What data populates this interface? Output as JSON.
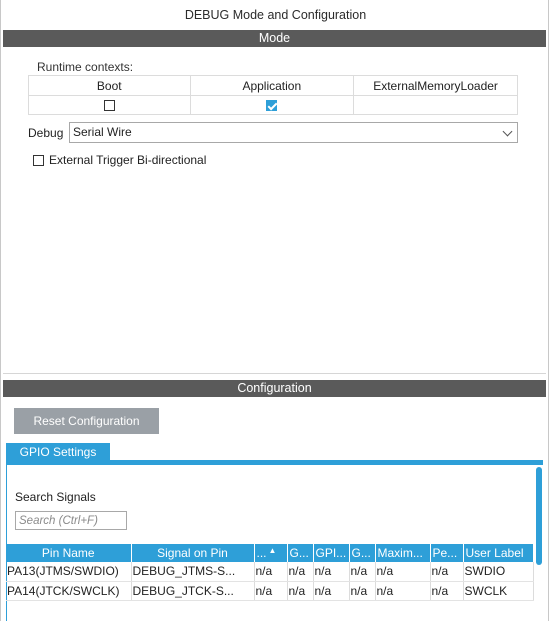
{
  "window": {
    "title": "DEBUG Mode and Configuration"
  },
  "mode": {
    "section_title": "Mode",
    "runtime_contexts_label": "Runtime contexts:",
    "contexts": [
      {
        "label": "Boot",
        "checked": false
      },
      {
        "label": "Application",
        "checked": true
      },
      {
        "label": "ExternalMemoryLoader",
        "checked": null
      }
    ],
    "debug_label": "Debug",
    "debug_value": "Serial Wire",
    "external_trigger_label": "External Trigger Bi-directional",
    "external_trigger_checked": false
  },
  "configuration": {
    "section_title": "Configuration",
    "reset_button": "Reset Configuration",
    "tabs": [
      {
        "label": "GPIO Settings",
        "active": true
      }
    ],
    "search_label": "Search Signals",
    "search_placeholder": "Search (Ctrl+F)",
    "table": {
      "columns": [
        "Pin Name",
        "Signal on Pin",
        "...",
        "G...",
        "GPI...",
        "G...",
        "Maxim...",
        "Pe...",
        "User Label"
      ],
      "rows": [
        [
          "PA13(JTMS/SWDIO)",
          "DEBUG_JTMS-S...",
          "n/a",
          "n/a",
          "n/a",
          "n/a",
          "n/a",
          "n/a",
          "SWDIO"
        ],
        [
          "PA14(JTCK/SWCLK)",
          "DEBUG_JTCK-S...",
          "n/a",
          "n/a",
          "n/a",
          "n/a",
          "n/a",
          "n/a",
          "SWCLK"
        ]
      ]
    }
  },
  "colors": {
    "accent": "#2e9fd8",
    "section_bar": "#5a5a5a",
    "button_disabled": "#9aa0a6"
  }
}
